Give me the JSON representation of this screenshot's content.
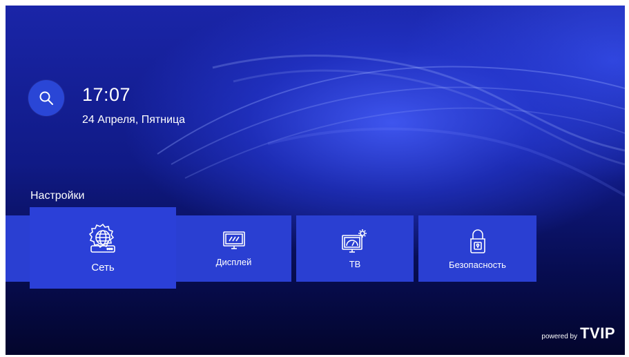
{
  "header": {
    "time": "17:07",
    "date": "24 Апреля, Пятница"
  },
  "search": {
    "icon": "search-icon"
  },
  "section": {
    "title": "Настройки"
  },
  "tiles": [
    {
      "label": "Сеть",
      "icon": "network-settings-icon",
      "selected": true
    },
    {
      "label": "Дисплей",
      "icon": "display-icon",
      "selected": false
    },
    {
      "label": "ТВ",
      "icon": "tv-settings-icon",
      "selected": false
    },
    {
      "label": "Безопасность",
      "icon": "lock-icon",
      "selected": false
    }
  ],
  "brand": {
    "prefix": "powered by",
    "name": "TVIP"
  },
  "colors": {
    "tile": "#2a3fd2",
    "search_button": "#2a46d6",
    "background_dark": "#03052c"
  }
}
